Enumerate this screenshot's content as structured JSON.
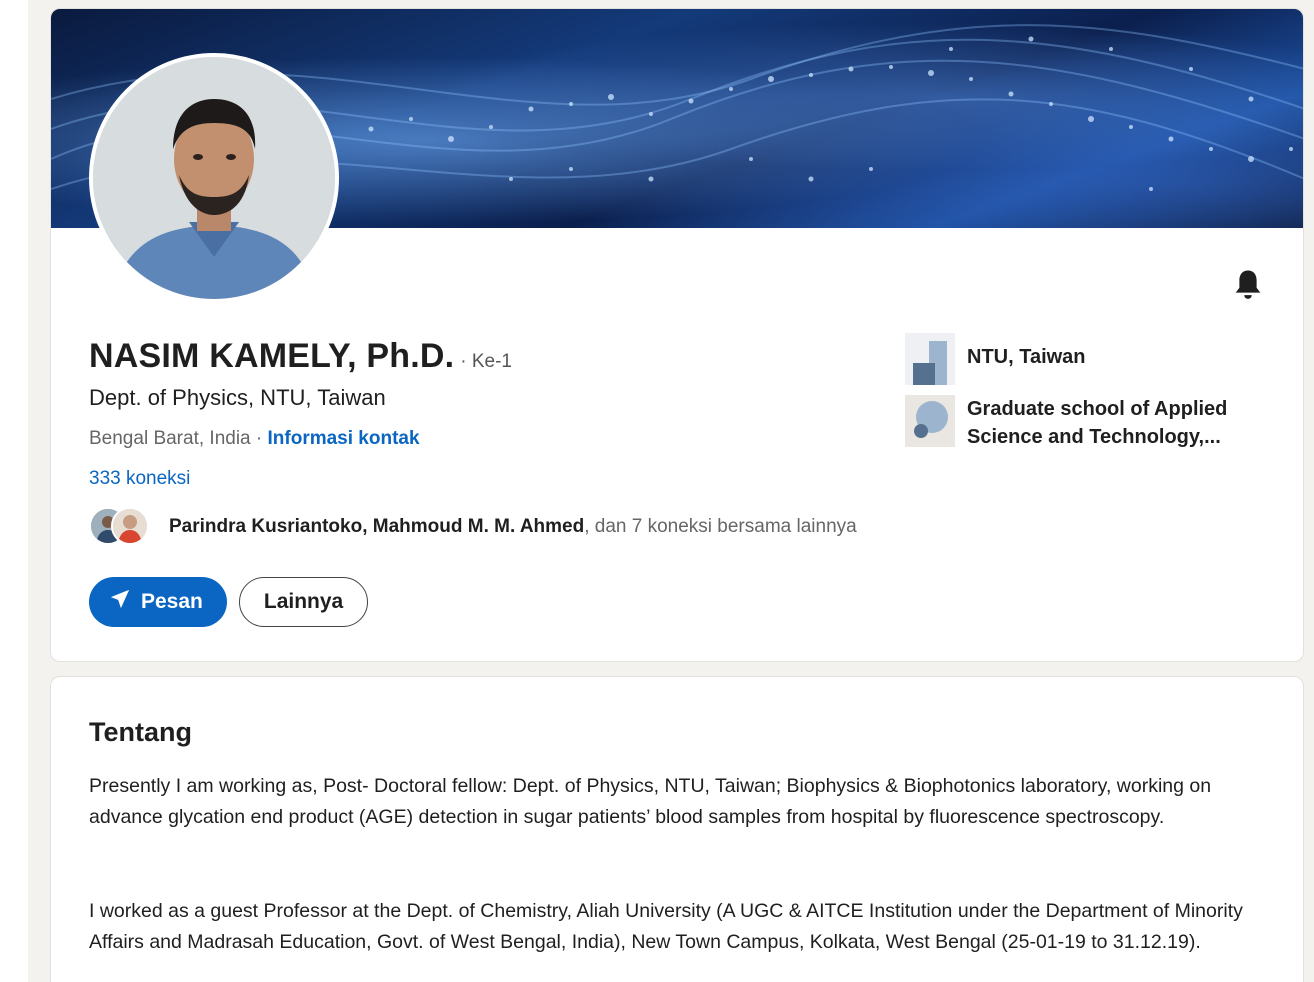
{
  "profile": {
    "name": "NASIM KAMELY, Ph.D.",
    "degree": "· Ke-1",
    "headline": "Dept. of Physics, NTU, Taiwan",
    "location": "Bengal Barat, India ·",
    "contact_link": "Informasi kontak",
    "connections": "333 koneksi",
    "mutual": {
      "names": "Parindra Kusriantoko, Mahmoud M. M. Ahmed",
      "suffix": ", dan 7 koneksi bersama lainnya"
    },
    "buttons": {
      "message": "Pesan",
      "more": "Lainnya"
    },
    "organizations": [
      {
        "name": "NTU, Taiwan"
      },
      {
        "name": "Graduate school of Applied Science and Technology,..."
      }
    ],
    "icons": {
      "bell": "bell-icon",
      "send": "send-icon"
    }
  },
  "about": {
    "title": "Tentang",
    "paragraphs": [
      "Presently I am working as, Post- Doctoral fellow: Dept. of Physics, NTU, Taiwan; Biophysics & Biophotonics laboratory, working on advance glycation end product (AGE) detection in sugar patients’ blood samples from hospital by fluorescence spectroscopy.",
      "I worked as a guest Professor at the Dept. of Chemistry, Aliah University (A UGC & AITCE Institution under the Department of Minority Affairs and Madrasah Education, Govt. of West Bengal, India), New Town Campus, Kolkata, West Bengal (25-01-19 to 31.12.19)."
    ]
  },
  "colors": {
    "accent": "#0a66c2",
    "page_bg": "#f4f2ee",
    "text": "#1f1f1f",
    "muted": "#666666"
  }
}
